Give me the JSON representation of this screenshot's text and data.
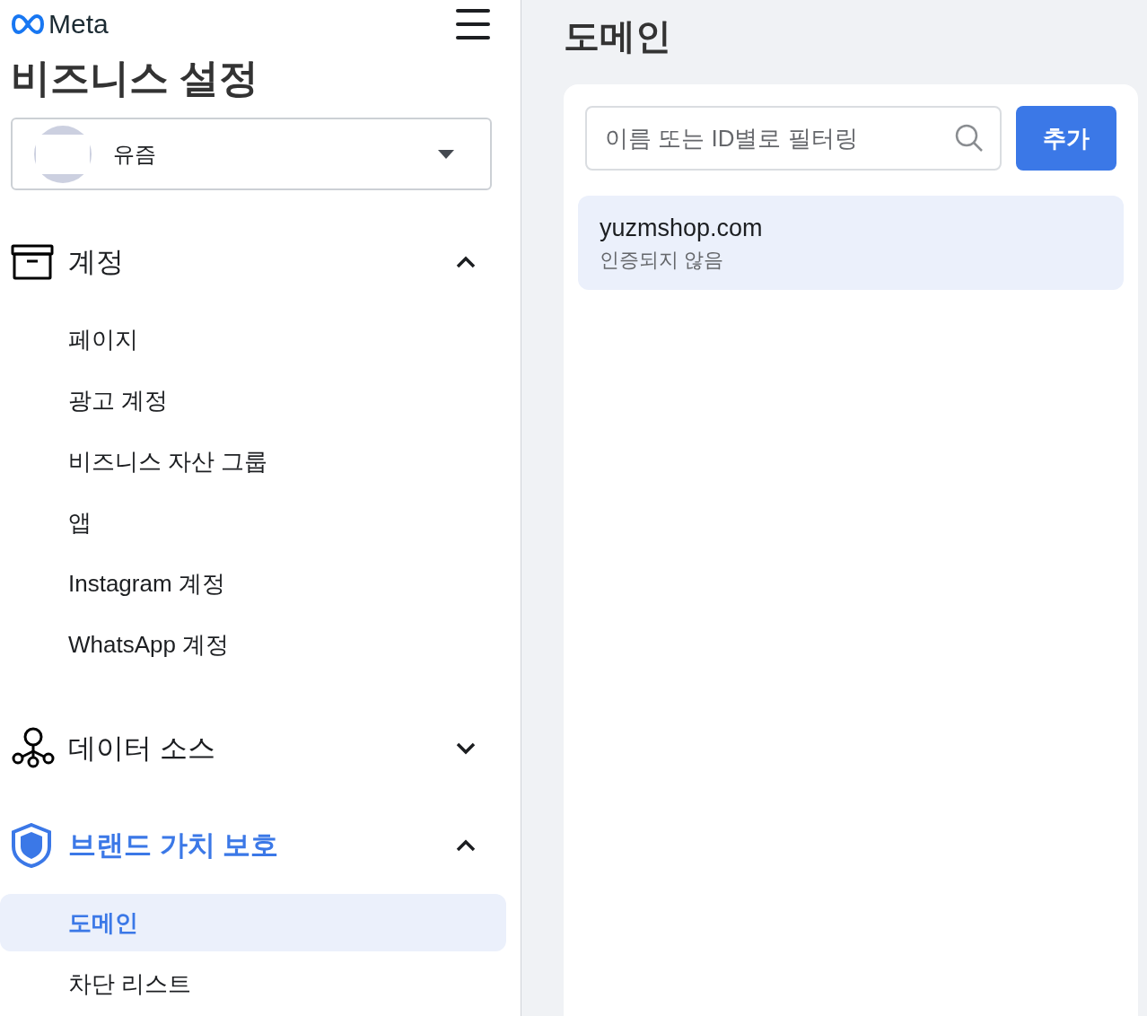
{
  "header": {
    "logo": "Meta",
    "title": "비즈니스 설정"
  },
  "account_selector": {
    "name": "유즘"
  },
  "sidebar": {
    "sections": [
      {
        "kind": "accounts",
        "label": "계정",
        "expanded": true,
        "active": false,
        "children": [
          {
            "label": "페이지",
            "selected": false
          },
          {
            "label": "광고 계정",
            "selected": false
          },
          {
            "label": "비즈니스 자산 그룹",
            "selected": false
          },
          {
            "label": "앱",
            "selected": false
          },
          {
            "label": "Instagram 계정",
            "selected": false
          },
          {
            "label": "WhatsApp 계정",
            "selected": false
          }
        ]
      },
      {
        "kind": "data",
        "label": "데이터 소스",
        "expanded": false,
        "active": false
      },
      {
        "kind": "brand",
        "label": "브랜드 가치 보호",
        "expanded": true,
        "active": true,
        "children": [
          {
            "label": "도메인",
            "selected": true
          },
          {
            "label": "차단 리스트",
            "selected": false
          }
        ]
      }
    ]
  },
  "main": {
    "title": "도메인",
    "search": {
      "placeholder": "이름 또는 ID별로 필터링"
    },
    "add_button": "추가",
    "domains": [
      {
        "name": "yuzmshop.com",
        "status": "인증되지 않음",
        "selected": true
      }
    ]
  }
}
